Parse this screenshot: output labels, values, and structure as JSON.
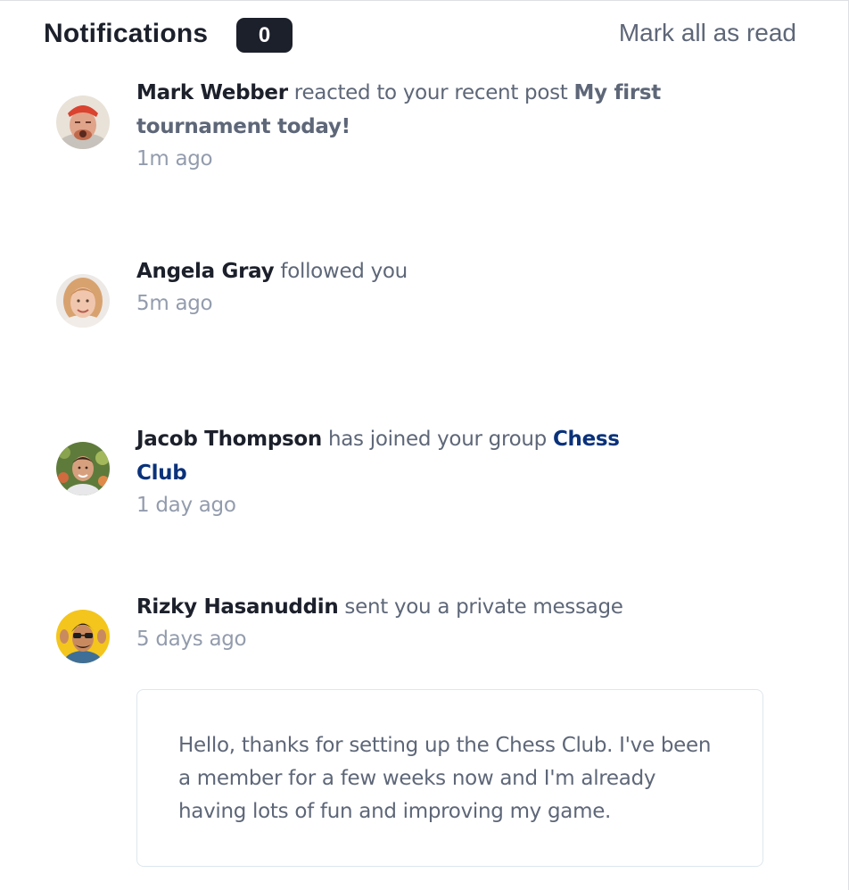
{
  "header": {
    "title": "Notifications",
    "unread_count": "0",
    "mark_all_label": "Mark all as read"
  },
  "notifications": [
    {
      "name": "Mark Webber",
      "action": "reacted to your recent post",
      "post": "My first tournament today!",
      "time": "1m ago",
      "avatar_icon": "avatar-mark-webber"
    },
    {
      "name": "Angela Gray",
      "action": "followed you",
      "time": "5m ago",
      "avatar_icon": "avatar-angela-gray"
    },
    {
      "name": "Jacob Thompson",
      "action": "has joined your group",
      "group": "Chess Club",
      "time": "1 day ago",
      "avatar_icon": "avatar-jacob-thompson"
    },
    {
      "name": "Rizky Hasanuddin",
      "action": "sent you a private message",
      "time": "5 days ago",
      "avatar_icon": "avatar-rizky-hasanuddin",
      "message": "Hello, thanks for setting up the Chess Club. I've been a member for a few weeks now and I'm already having lots of fun and improving my game."
    }
  ],
  "colors": {
    "heading": "#1c202b",
    "text": "#5e6778",
    "muted": "#939cad",
    "group_link": "#0a327b",
    "badge_bg": "#1c202b"
  }
}
